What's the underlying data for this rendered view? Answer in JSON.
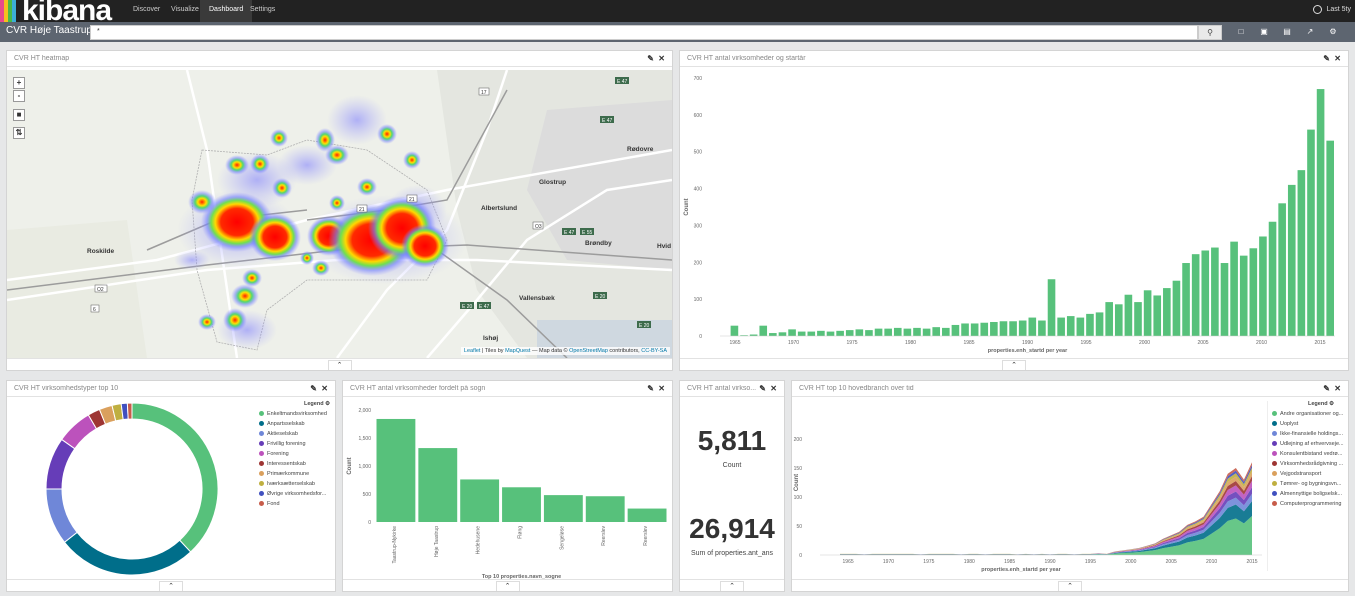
{
  "nav": {
    "logo": "kibana",
    "items": [
      "Discover",
      "Visualize",
      "Dashboard",
      "Settings"
    ],
    "active": "Dashboard",
    "time": "Last 5ty"
  },
  "toolbar": {
    "dashboard_title": "CVR Høje Taastrup",
    "query": "*"
  },
  "colors": {
    "green": "#57c17b",
    "teal": "#006e8a",
    "blue": "#6f87d8",
    "purple": "#663db8",
    "magenta": "#bc52bc",
    "maroon": "#9e3533",
    "orange": "#daa05d",
    "yellow": "#bfaf40",
    "indigo": "#4050bf",
    "red": "#c75c4a",
    "lavender": "#8e7fc8"
  },
  "panels": {
    "heatmap": {
      "title": "CVR HT heatmap",
      "attribution": [
        "Leaflet",
        "| Tiles by",
        "MapQuest",
        "— Map data ©",
        "OpenStreetMap",
        "contributors,",
        "CC-BY-SA"
      ],
      "places": [
        "Roskilde",
        "Glostrup",
        "Rødovre",
        "Albertslund",
        "Brøndby",
        "Hvid",
        "Vallensbæk",
        "Ishøj"
      ],
      "roads": [
        "E 47",
        "E 47",
        "21",
        "17",
        "21",
        "O3",
        "O2",
        "E 47",
        "E 55",
        "E 20",
        "E 47",
        "E 20",
        "E 20",
        "6"
      ]
    },
    "yearly": {
      "title": "CVR HT antal virksomheder og startår"
    },
    "types": {
      "title": "CVR HT virksomhedstyper top 10",
      "legend_title": "Legend"
    },
    "parish": {
      "title": "CVR HT antal virksomheder fordelt på sogn"
    },
    "metric": {
      "title": "CVR HT antal virkso...",
      "values": [
        {
          "value": "5,811",
          "label": "Count"
        },
        {
          "value": "26,914",
          "label": "Sum of properties.ant_ans"
        }
      ]
    },
    "top10": {
      "title": "CVR HT top 10 hovedbranch over tid",
      "legend_title": "Legend"
    }
  },
  "chart_data": [
    {
      "type": "bar",
      "title": "CVR HT antal virksomheder og startår",
      "ylabel": "Count",
      "xlabel": "properties.enh_startd per year",
      "ylim": [
        0,
        700
      ],
      "yticks": [
        0,
        100,
        200,
        300,
        400,
        500,
        600,
        700
      ],
      "xticks": [
        "1965",
        "1970",
        "1975",
        "1980",
        "1985",
        "1990",
        "1995",
        "2000",
        "2005",
        "2010",
        "2015"
      ],
      "x": [
        1964,
        1965,
        1966,
        1967,
        1968,
        1969,
        1970,
        1971,
        1972,
        1973,
        1974,
        1975,
        1976,
        1977,
        1978,
        1979,
        1980,
        1981,
        1982,
        1983,
        1984,
        1985,
        1986,
        1987,
        1988,
        1989,
        1990,
        1991,
        1992,
        1993,
        1994,
        1995,
        1996,
        1997,
        1998,
        1999,
        2000,
        2001,
        2002,
        2003,
        2004,
        2005,
        2006,
        2007,
        2008,
        2009,
        2010,
        2011,
        2012,
        2013,
        2014,
        2015
      ],
      "values": [
        0,
        28,
        2,
        4,
        28,
        8,
        10,
        18,
        12,
        12,
        14,
        12,
        14,
        16,
        18,
        16,
        20,
        20,
        22,
        20,
        22,
        20,
        24,
        22,
        30,
        34,
        34,
        36,
        38,
        40,
        40,
        42,
        50,
        42,
        154,
        50,
        54,
        50,
        60,
        64,
        92,
        86,
        112,
        92,
        124,
        110,
        130,
        150,
        198,
        222,
        232,
        240,
        198,
        256,
        218,
        238,
        270,
        310,
        360,
        410,
        450,
        560,
        670,
        530
      ],
      "series_note": ""
    },
    {
      "type": "pie",
      "title": "CVR HT virksomhedstyper top 10",
      "legend": [
        "Enkeltmandsvirksomhed",
        "Anpartsselskab",
        "Aktieselskab",
        "Frivillig forening",
        "Forening",
        "Interessentskab",
        "Primærkommune",
        "Iværksætterselskab",
        "Øvrige virksomhedsfor...",
        "Fond"
      ],
      "values": [
        2650,
        1830,
        740,
        680,
        470,
        160,
        170,
        120,
        80,
        60
      ]
    },
    {
      "type": "bar",
      "title": "CVR HT antal virksomheder fordelt på sogn",
      "ylabel": "Count",
      "xlabel": "Top 10 properties.navn_sogne",
      "ylim": [
        0,
        2000
      ],
      "yticks": [
        "0",
        "500",
        "1,000",
        "1,500",
        "2,000"
      ],
      "categories": [
        "Taastrup-Nykirke",
        "Høje Taastrup",
        "Hedehusene",
        "Fløng",
        "Sengeløse",
        "Reerslev",
        "Reerslev"
      ],
      "values": [
        1840,
        1320,
        760,
        620,
        480,
        460,
        240
      ]
    },
    {
      "type": "area",
      "title": "CVR HT top 10 hovedbranch over tid",
      "ylabel": "Count",
      "xlabel": "properties.enh_startd per year",
      "ylim": [
        0,
        250
      ],
      "yticks": [
        "0",
        "50",
        "100",
        "150",
        "200"
      ],
      "xticks": [
        "1965",
        "1970",
        "1975",
        "1980",
        "1985",
        "1990",
        "1995",
        "2000",
        "2005",
        "2010",
        "2015"
      ],
      "legend": [
        "Andre organisationer og...",
        "Uoplyst",
        "Ikke-finansielle holdings...",
        "Udlejning af erhvervseje...",
        "Konsulentbistand vedrø...",
        "Virksomhedsrådgivning ...",
        "Vejgodstransport",
        "Tømrer- og bygningsvn...",
        "Almennyttige boligselsk...",
        "Computerprogrammering"
      ]
    }
  ]
}
